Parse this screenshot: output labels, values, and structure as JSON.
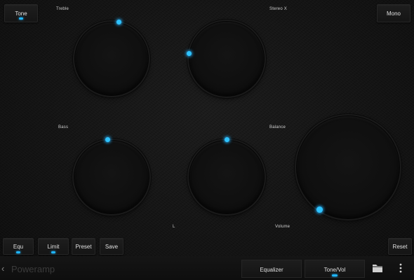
{
  "top_buttons": {
    "tone": "Tone",
    "mono": "Mono"
  },
  "knobs": {
    "treble": {
      "label": "Treble",
      "level": 0.55
    },
    "stereo": {
      "label": "Stereo X",
      "level": 0.0
    },
    "bass": {
      "label": "Bass",
      "level": 0.47
    },
    "balance": {
      "label": "Balance",
      "level": 0.5
    },
    "volume": {
      "label": "Volume",
      "level": 0.0
    }
  },
  "balance_left_label": "L",
  "bottom_buttons": {
    "equ": "Equ",
    "limit": "Limit",
    "preset": "Preset",
    "save": "Save",
    "reset": "Reset"
  },
  "nav": {
    "back_glyph": "‹",
    "app_title": "Poweramp",
    "tabs": [
      "Equalizer",
      "Tone/Vol"
    ],
    "active_tab": "Tone/Vol",
    "folder_icon": "folder-icon",
    "menu_icon": "overflow-menu-icon"
  },
  "colors": {
    "accent": "#2ec3ff",
    "background": "#141414"
  }
}
